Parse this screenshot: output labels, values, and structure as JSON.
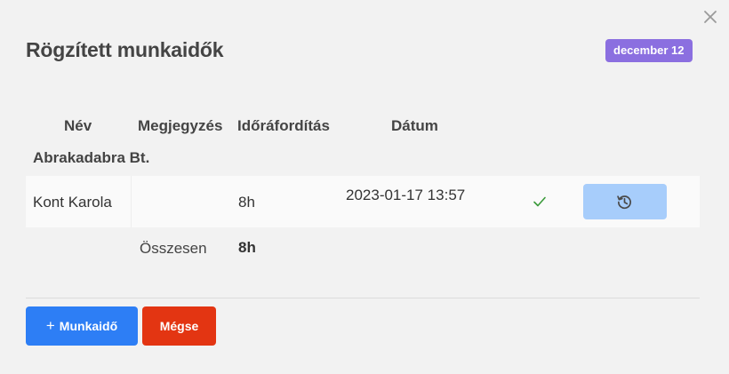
{
  "dialog": {
    "title": "Rögzített munkaidők",
    "date_badge": "december 12",
    "close_icon": "close-icon"
  },
  "table": {
    "columns": [
      "Név",
      "Megjegyzés",
      "Időráfordítás",
      "Dátum"
    ],
    "group": "Abrakadabra Bt.",
    "rows": [
      {
        "name": "Kont Karola",
        "note": "",
        "hours": "8h",
        "date": "2023-01-17 13:57",
        "status_icon": "check-icon",
        "action_icon": "history-icon"
      }
    ],
    "total_label": "Összesen",
    "total_value": "8h"
  },
  "footer": {
    "add_label": "Munkaidő",
    "add_icon": "plus-icon",
    "cancel_label": "Mégse"
  },
  "colors": {
    "badge": "#8b6fe0",
    "primary": "#2d7ef5",
    "danger": "#e33512",
    "history_button": "#a7cdfb",
    "check": "#3a9a3a"
  }
}
